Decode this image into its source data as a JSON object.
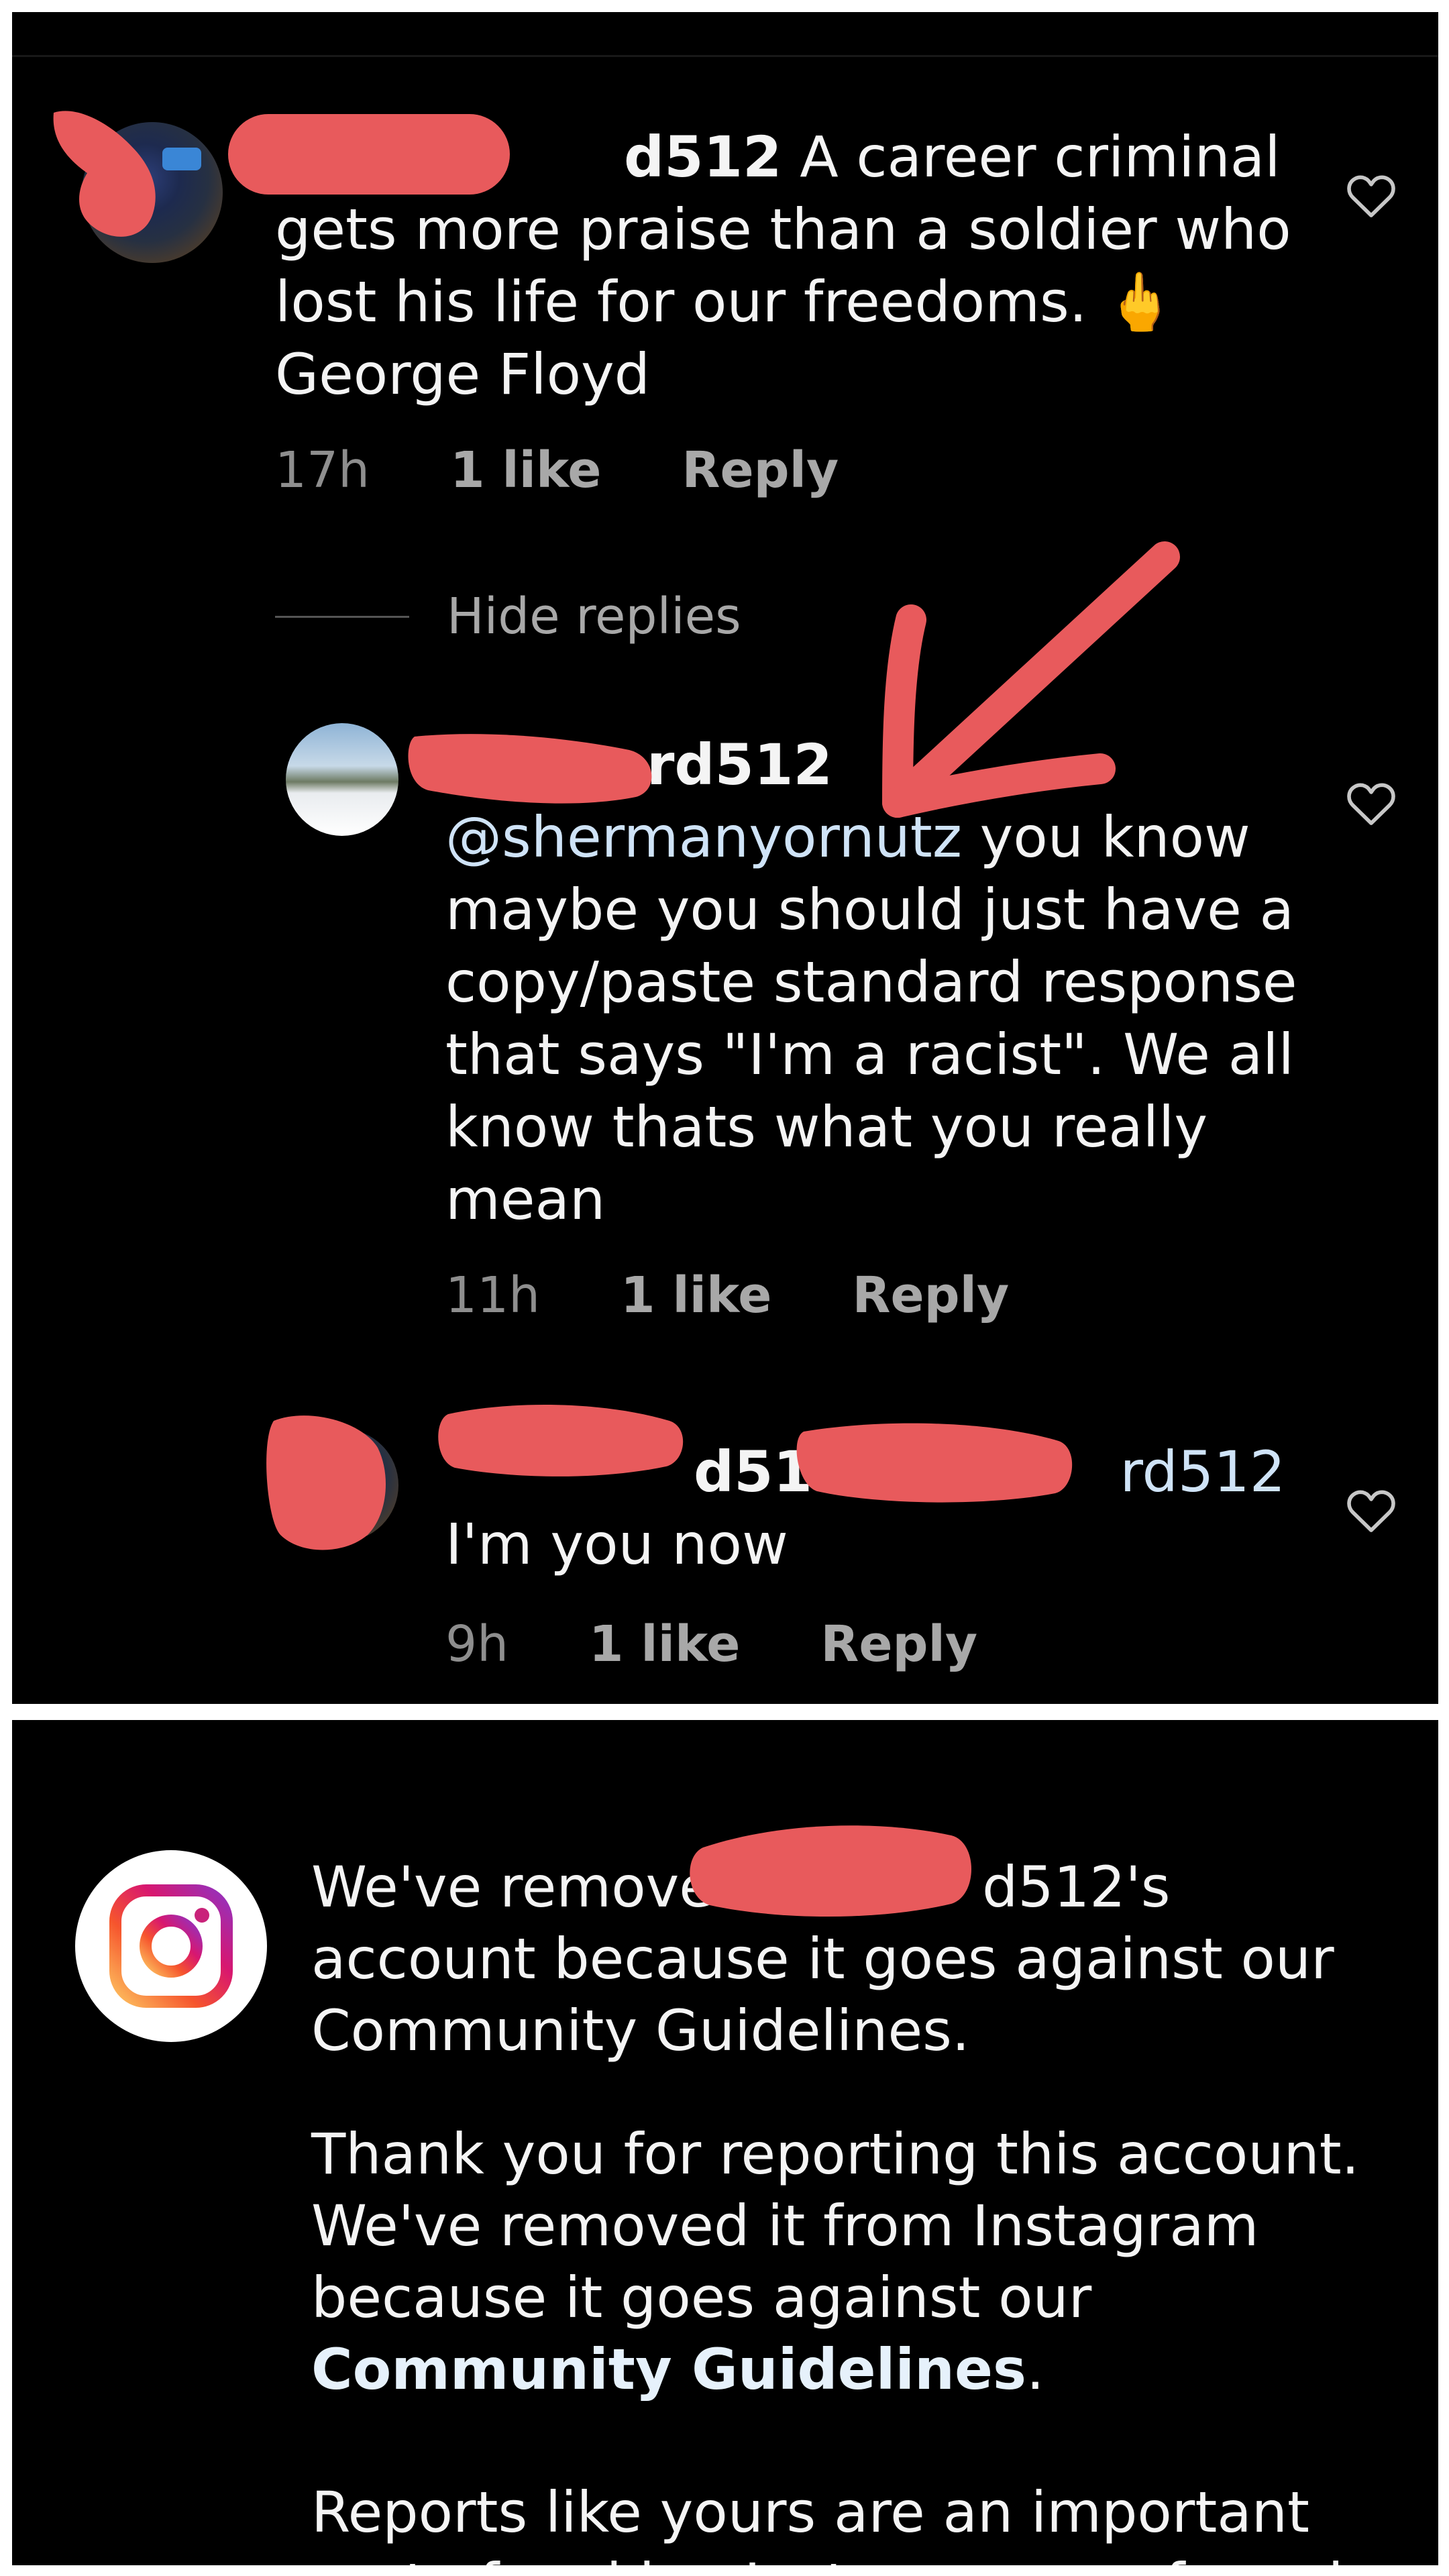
{
  "comment1": {
    "username_visible": "d512",
    "text": "A career criminal gets more praise than a soldier who lost his life for our freedoms.",
    "emoji": "🖕",
    "text_after_emoji": "George Floyd",
    "time": "17h",
    "likes": "1 like",
    "reply": "Reply"
  },
  "hide_replies": "Hide replies",
  "comment2": {
    "username_visible": "rd512",
    "mention": "@shermanyornutz",
    "text": "you know maybe you should just have a copy/paste standard response that says \"I'm a racist\". We all know thats what you really mean",
    "time": "11h",
    "likes": "1 like",
    "reply": "Reply"
  },
  "comment3": {
    "username_visible": "d512",
    "mention_visible": "rd512",
    "text": "I'm you now",
    "time": "9h",
    "likes": "1 like",
    "reply": "Reply"
  },
  "notice": {
    "line1_start": "We've remove",
    "line1_end": "d512's",
    "line1_rest": "account because it goes against our Community Guidelines.",
    "para2": "Thank you for reporting this account. We've removed it from Instagram because it goes against our",
    "para2_link": "Community Guidelines",
    "para2_end": ".",
    "para3": "Reports like yours are an important part of making Instagram a safe and"
  },
  "colors": {
    "background": "#000000",
    "text": "#f4f4f4",
    "muted": "#a8a8a8",
    "mention": "#cfe3f7",
    "redaction": "#e85a5c"
  },
  "icons": [
    "heart-icon",
    "instagram-icon",
    "arrow-annotation"
  ]
}
